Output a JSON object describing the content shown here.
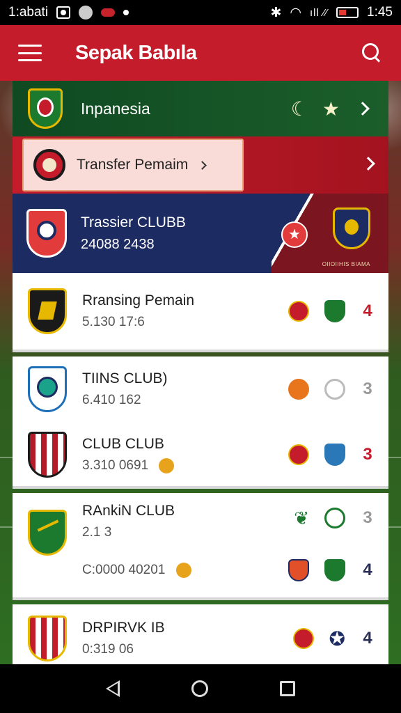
{
  "status_bar": {
    "carrier": "1:abati",
    "time": "1:45",
    "signal_text": "ıll ⁄⁄"
  },
  "app_bar": {
    "title": "Sepak Babıla"
  },
  "featured": [
    {
      "title": "Inpanesia"
    },
    {
      "title": "Transfer Pemaim"
    },
    {
      "title": "Trassier CLUBB",
      "sub": "24088 2438",
      "mini_caption": "OIIOIIHIS BIAMA"
    }
  ],
  "entries": [
    {
      "title": "Rransing Pemain",
      "sub": "5.130 17:6",
      "num": "4"
    },
    {
      "title": "TIINS CLUB)",
      "sub": "6.410 162",
      "num": "3"
    },
    {
      "title": "CLUB CLUB",
      "sub": "3.310 0691",
      "num": "3"
    },
    {
      "title": "RAnkiN CLUB",
      "sub": "2.1 3",
      "num": "3"
    },
    {
      "title": "",
      "sub": "C:0000 40201",
      "num": "4"
    },
    {
      "title": "DRPIRVK IB",
      "sub": "0:319 06",
      "num": "4"
    }
  ],
  "colors": {
    "brand_red": "#c41c2a",
    "navy": "#1d2b63",
    "green": "#1b5e2a"
  }
}
